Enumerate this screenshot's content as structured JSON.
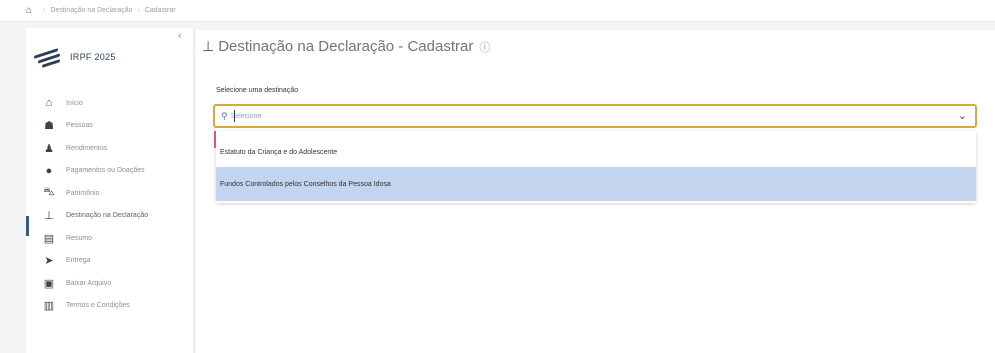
{
  "breadcrumb": {
    "home_icon": "home-icon",
    "items": [
      "Destinação na Declaração",
      "Cadastrar"
    ]
  },
  "sidebar": {
    "logo_label": "IRPF 2025",
    "collapse_glyph": "‹",
    "items": [
      {
        "label": "Início",
        "icon": "home-icon",
        "glyph": "⌂"
      },
      {
        "label": "Pessoas",
        "icon": "people-icon",
        "glyph": "☗"
      },
      {
        "label": "Rendimentos",
        "icon": "money-bag-icon",
        "glyph": "♟"
      },
      {
        "label": "Pagamentos ou Doações",
        "icon": "donation-icon",
        "glyph": "●"
      },
      {
        "label": "Patrimônio",
        "icon": "car-icon",
        "glyph": "⛍"
      },
      {
        "label": "Destinação na Declaração",
        "icon": "destination-icon",
        "glyph": "⊥",
        "active": true
      },
      {
        "label": "Resumo",
        "icon": "summary-icon",
        "glyph": "▤"
      },
      {
        "label": "Entrega",
        "icon": "send-icon",
        "glyph": "➤"
      },
      {
        "label": "Baixar Arquivo",
        "icon": "download-file-icon",
        "glyph": "▣"
      },
      {
        "label": "Termos e Condições",
        "icon": "terms-icon",
        "glyph": "▥"
      }
    ]
  },
  "main": {
    "title": "Destinação na Declaração - Cadastrar",
    "title_icon": "destination-icon",
    "help_icon": "help-circle-icon",
    "field_label": "Selecione uma destinação",
    "select": {
      "placeholder": "Selecione",
      "search_icon": "search-icon",
      "chevron_icon": "chevron-down-icon"
    },
    "options": [
      "Estatuto da Criança e do Adolescente",
      "Fundos Controlados pelos Conselhos da Pessoa Idosa"
    ],
    "highlighted_option_index": 1
  },
  "colors": {
    "accent": "#3a5a82",
    "focus_border": "#d7a93a",
    "highlight": "#c3d4ee"
  }
}
